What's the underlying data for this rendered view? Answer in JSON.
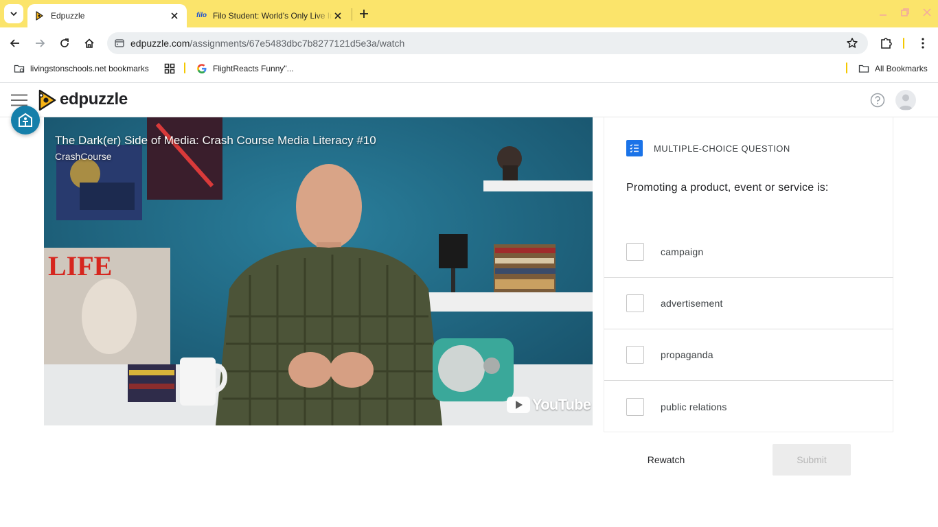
{
  "browser": {
    "tabs": [
      {
        "title": "Edpuzzle",
        "favicon": "edpuzzle-favicon-icon",
        "active": true
      },
      {
        "title": "Filo Student: World's Only Live Instant Tutoring",
        "favicon_text": "filo",
        "active": false
      }
    ],
    "url_host": "edpuzzle.com",
    "url_path": "/assignments/67e5483dbc7b8277121d5e3a/watch",
    "bookmarks": [
      {
        "label": "livingstonschools.net bookmarks",
        "icon": "managed-folder-icon"
      },
      {
        "label": "FlightReacts Funny\"...",
        "icon": "google-icon"
      }
    ],
    "all_bookmarks": "All Bookmarks",
    "tabbar_color": "#fbe46b"
  },
  "header": {
    "brand": "edpuzzle",
    "logo_color": "#f6b316"
  },
  "video": {
    "title": "The Dark(er) Side of Media: Crash Course Media Literacy #10",
    "channel": "CrashCourse",
    "watermark": "YouTube"
  },
  "question": {
    "type_label": "MULTIPLE-CHOICE QUESTION",
    "text": "Promoting a product, event or service is:",
    "options": [
      {
        "label": "campaign",
        "checked": false
      },
      {
        "label": "advertisement",
        "checked": false
      },
      {
        "label": "propaganda",
        "checked": false
      },
      {
        "label": "public relations",
        "checked": false
      }
    ],
    "accent_color": "#1a73e8"
  },
  "actions": {
    "rewatch_label": "Rewatch",
    "submit_label": "Submit",
    "submit_disabled": true
  }
}
